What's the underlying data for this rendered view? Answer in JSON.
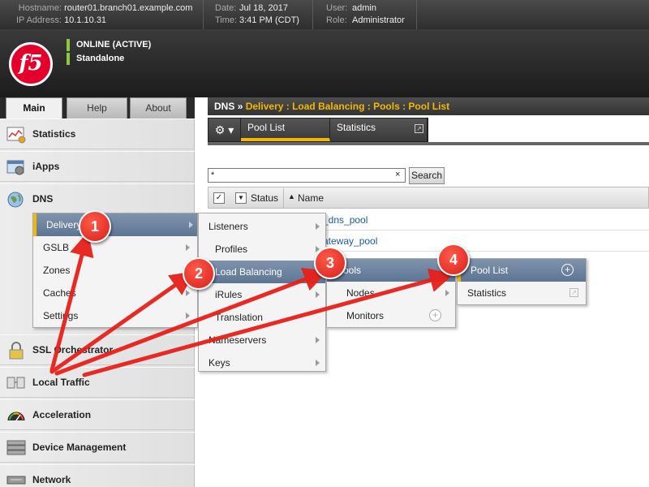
{
  "header": {
    "hostname_label": "Hostname:",
    "hostname": "router01.branch01.example.com",
    "ip_label": "IP Address:",
    "ip": "10.1.10.31",
    "date_label": "Date:",
    "date": "Jul 18, 2017",
    "time_label": "Time:",
    "time": "3:41 PM (CDT)",
    "user_label": "User:",
    "user": "admin",
    "role_label": "Role:",
    "role": "Administrator"
  },
  "status": {
    "logo_text": "f5",
    "online": "ONLINE (ACTIVE)",
    "mode": "Standalone",
    "status_color": "#8dc63f"
  },
  "left_tabs": [
    "Main",
    "Help",
    "About"
  ],
  "nav": {
    "items": [
      {
        "label": "Statistics",
        "icon": "statistics-chart-icon"
      },
      {
        "label": "iApps",
        "icon": "iapps-icon"
      },
      {
        "label": "DNS",
        "icon": "globe-icon"
      },
      {
        "label": "SSL Orchestrator",
        "icon": "padlock-icon"
      },
      {
        "label": "Local Traffic",
        "icon": "local-traffic-icon"
      },
      {
        "label": "Acceleration",
        "icon": "speedometer-icon"
      },
      {
        "label": "Device Management",
        "icon": "server-stack-icon"
      },
      {
        "label": "Network",
        "icon": "network-icon"
      }
    ],
    "dns_submenu": [
      "Delivery",
      "GSLB",
      "Zones",
      "Caches",
      "Settings"
    ]
  },
  "delivery_menu": [
    "Listeners",
    "Profiles",
    "Load Balancing",
    "iRules",
    "Translation",
    "Nameservers",
    "Keys"
  ],
  "lb_menu": [
    "Pools",
    "Nodes",
    "Monitors"
  ],
  "pools_menu": [
    "Pool List",
    "Statistics"
  ],
  "breadcrumb": {
    "section": "DNS",
    "sep": "»",
    "path": "Delivery : Load Balancing : Pools : Pool List"
  },
  "subtabs": [
    "Pool List",
    "Statistics"
  ],
  "search": {
    "value": "*",
    "clear": "×",
    "button": "Search"
  },
  "grid": {
    "columns": [
      "Status",
      "Name"
    ],
    "rows": [
      "_dns_pool",
      "ateway_pool"
    ]
  },
  "callouts": [
    "1",
    "2",
    "3",
    "4"
  ],
  "colors": {
    "accent": "#f5b800",
    "highlight": "#6a80a0",
    "arrow": "#e8201a",
    "link": "#1a5aa8"
  }
}
